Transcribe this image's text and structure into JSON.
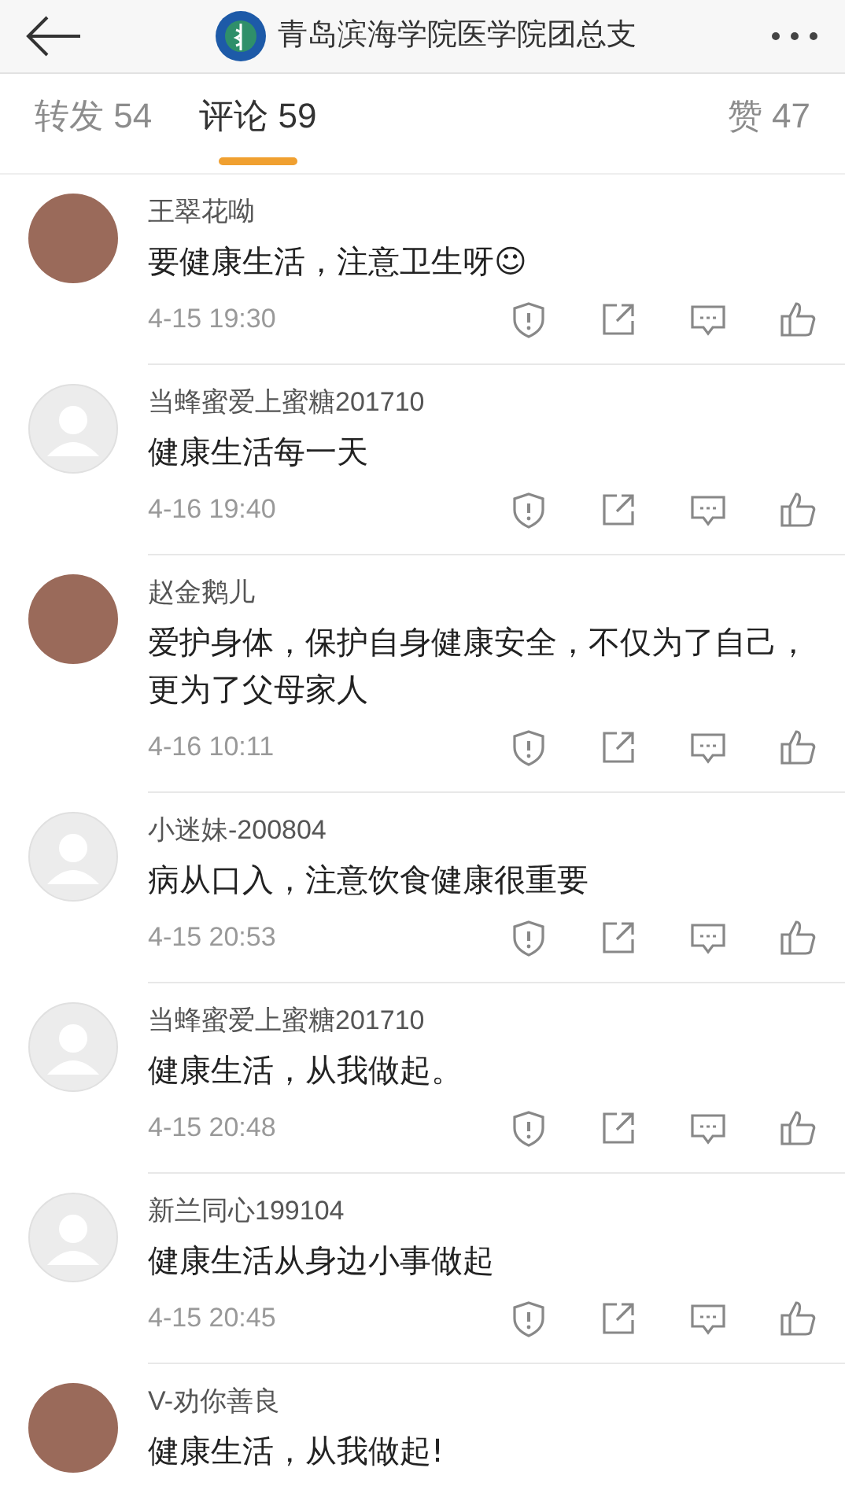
{
  "header": {
    "title": "青岛滨海学院医学院团总支"
  },
  "tabs": [
    {
      "label": "转发 54",
      "selected": false
    },
    {
      "label": "评论 59",
      "selected": true
    },
    {
      "label": "赞 47",
      "selected": false
    }
  ],
  "comments": [
    {
      "kind": "photo",
      "name": "王翠花呦",
      "text": "要健康生活，注意卫生呀☺",
      "time": "4-15 19:30"
    },
    {
      "kind": "default",
      "name": "当蜂蜜爱上蜜糖201710",
      "text": "健康生活每一天",
      "time": "4-16 19:40"
    },
    {
      "kind": "photo",
      "name": "赵金鹅儿",
      "text": "爱护身体，保护自身健康安全，不仅为了自己，更为了父母家人",
      "time": "4-16 10:11"
    },
    {
      "kind": "default",
      "name": "小迷妹-200804",
      "text": "病从口入，注意饮食健康很重要",
      "time": "4-15 20:53"
    },
    {
      "kind": "default",
      "name": "当蜂蜜爱上蜜糖201710",
      "text": "健康生活，从我做起。",
      "time": "4-15 20:48"
    },
    {
      "kind": "default",
      "name": "新兰同心199104",
      "text": "健康生活从身边小事做起",
      "time": "4-15 20:45"
    },
    {
      "kind": "photo",
      "name": "V-劝你善良",
      "text": "健康生活，从我做起!"
    }
  ]
}
